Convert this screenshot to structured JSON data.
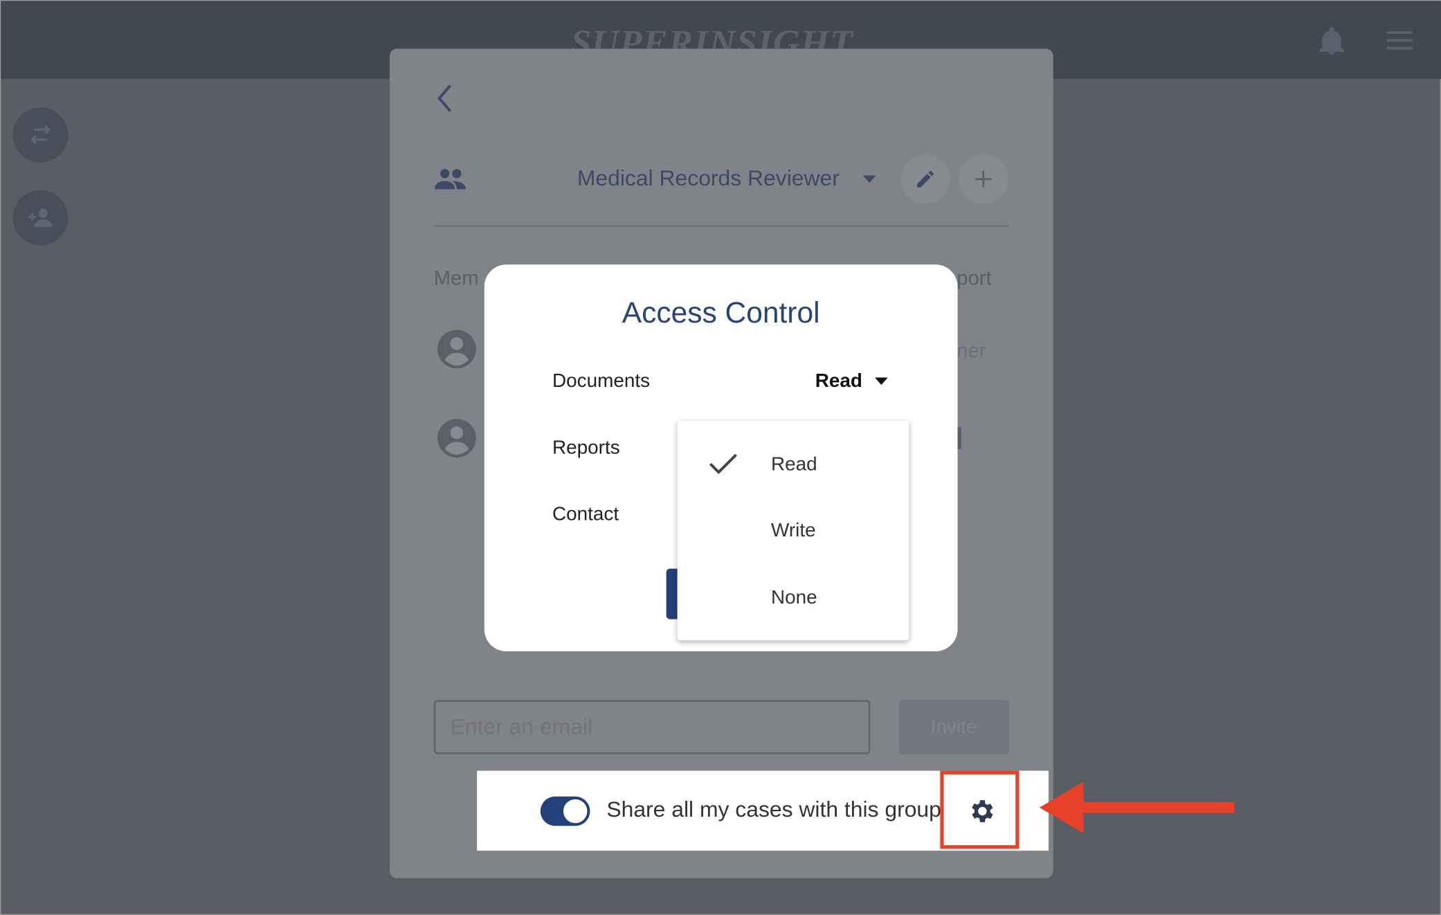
{
  "header": {
    "logo": "SUPERINSIGHT",
    "icons": [
      "bell-icon",
      "menu-icon"
    ]
  },
  "sidebar": {
    "buttons": [
      "swap-icon",
      "add-user-icon"
    ]
  },
  "group": {
    "name": "Medical Records Reviewer"
  },
  "members": {
    "label_fragment": "Mem",
    "right_fragment": "port",
    "role_fragment": "ner"
  },
  "dialog": {
    "title": "Access Control",
    "rows": [
      {
        "label": "Documents",
        "value": "Read"
      },
      {
        "label": "Reports"
      },
      {
        "label": "Contact"
      }
    ],
    "menu": {
      "options": [
        "Read",
        "Write",
        "None"
      ],
      "selected": "Read"
    }
  },
  "invite": {
    "placeholder": "Enter an email",
    "button": "Invite"
  },
  "share": {
    "label": "Share all my cases with this group",
    "toggle_on": true
  },
  "colors": {
    "accent": "#23407a",
    "annotation": "#e8412a",
    "header": "#414852"
  }
}
